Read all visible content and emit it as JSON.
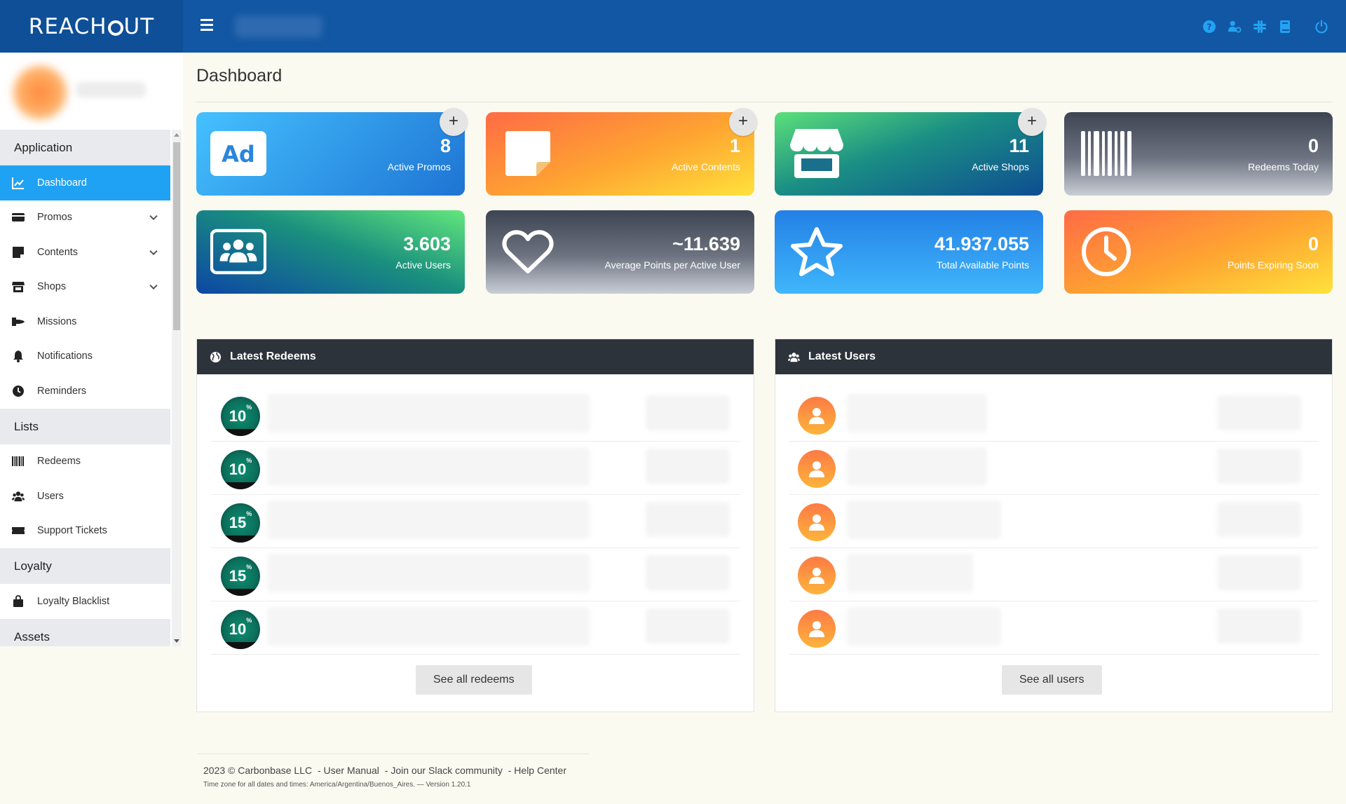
{
  "app": {
    "brand_left": "REACH",
    "brand_right": "UT"
  },
  "colors": {
    "topbar": "#1257a3",
    "active": "#20a2f4",
    "panel_header": "#2d333b"
  },
  "topbar": {
    "icons": [
      "help-icon",
      "user-cog-icon",
      "slack-icon",
      "book-icon",
      "power-icon"
    ]
  },
  "sidebar": {
    "sections": {
      "application": "Application",
      "lists": "Lists",
      "loyalty": "Loyalty",
      "assets": "Assets"
    },
    "items": {
      "dashboard": "Dashboard",
      "promos": "Promos",
      "contents": "Contents",
      "shops": "Shops",
      "missions": "Missions",
      "notifications": "Notifications",
      "reminders": "Reminders",
      "redeems": "Redeems",
      "users": "Users",
      "support": "Support Tickets",
      "blacklist": "Loyalty Blacklist"
    }
  },
  "main": {
    "title": "Dashboard"
  },
  "cards": [
    {
      "value": "8",
      "label": "Active Promos",
      "icon": "ad-icon"
    },
    {
      "value": "1",
      "label": "Active Contents",
      "icon": "note-icon"
    },
    {
      "value": "11",
      "label": "Active Shops",
      "icon": "store-icon"
    },
    {
      "value": "0",
      "label": "Redeems Today",
      "icon": "barcode-icon"
    },
    {
      "value": "3.603",
      "label": "Active Users",
      "icon": "users-icon"
    },
    {
      "value": "~11.639",
      "label": "Average Points per Active User",
      "icon": "heart-icon"
    },
    {
      "value": "41.937.055",
      "label": "Total Available Points",
      "icon": "star-icon"
    },
    {
      "value": "0",
      "label": "Points Expiring Soon",
      "icon": "clock-icon"
    }
  ],
  "plus_label": "+",
  "latest_redeems": {
    "title": "Latest Redeems",
    "button": "See all redeems",
    "rows": [
      {
        "discount": "10",
        "unit": "%"
      },
      {
        "discount": "10",
        "unit": "%"
      },
      {
        "discount": "15",
        "unit": "%"
      },
      {
        "discount": "15",
        "unit": "%"
      },
      {
        "discount": "10",
        "unit": "%"
      }
    ]
  },
  "latest_users": {
    "title": "Latest Users",
    "button": "See all users"
  },
  "footer": {
    "copyright": "2023 © Carbonbase LLC",
    "user_manual": "- User Manual",
    "slack": "- Join our Slack community",
    "help": "- Help Center",
    "timezone": "Time zone for all dates and times: America/Argentina/Buenos_Aires. — Version 1.20.1"
  }
}
